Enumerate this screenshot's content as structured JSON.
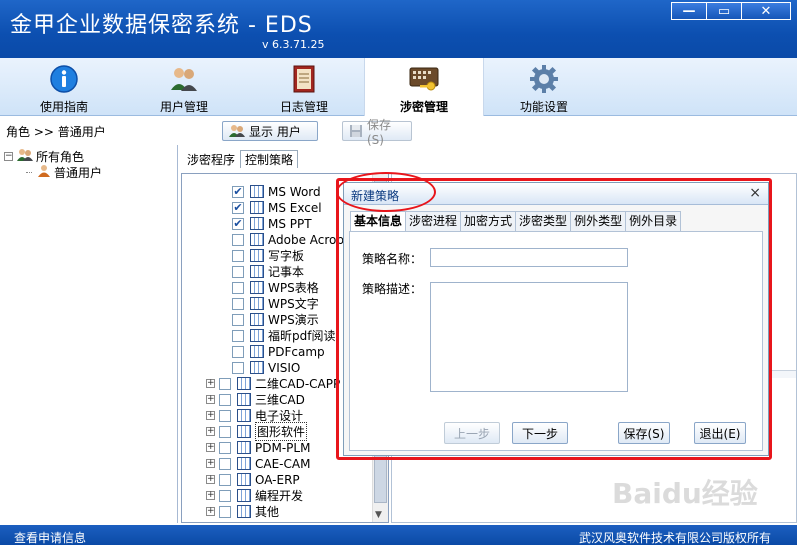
{
  "window": {
    "title": "金甲企业数据保密系统 - EDS",
    "version": "v 6.3.71.25",
    "minimize": "—",
    "restore": "▭",
    "close": "✕"
  },
  "toolbar": {
    "tabs": [
      {
        "label": "使用指南",
        "icon": "info-icon"
      },
      {
        "label": "用户管理",
        "icon": "users-icon"
      },
      {
        "label": "日志管理",
        "icon": "log-book-icon"
      },
      {
        "label": "涉密管理",
        "icon": "key-keyboard-icon"
      },
      {
        "label": "功能设置",
        "icon": "gear-icon"
      }
    ],
    "active": "涉密管理"
  },
  "breadcrumb": "角色 >> 普通用户",
  "buttons": {
    "show_user": "显示 用户",
    "save": "保存(S)"
  },
  "role_tree": {
    "root": "所有角色",
    "child": "普通用户"
  },
  "mid_tabs": [
    "涉密程序",
    "控制策略"
  ],
  "program_list": {
    "checked_items": [
      "MS Word",
      "MS Excel",
      "MS PPT"
    ],
    "unchecked_items": [
      "Adobe Acrob",
      "写字板",
      "记事本",
      "WPS表格",
      "WPS文字",
      "WPS演示",
      "福昕pdf阅读",
      "PDFcamp",
      "VISIO"
    ],
    "groups": [
      "二维CAD-CAPP",
      "三维CAD",
      "电子设计",
      "图形软件",
      "PDM-PLM",
      "CAE-CAM",
      "OA-ERP",
      "编程开发",
      "其他"
    ],
    "selected_group": "图形软件"
  },
  "dialog": {
    "title": "新建策略",
    "close": "×",
    "tabs": [
      "基本信息",
      "涉密进程",
      "加密方式",
      "涉密类型",
      "例外类型",
      "例外目录"
    ],
    "active_tab": "基本信息",
    "name_label": "策略名称：",
    "name_value": "",
    "desc_label": "策略描述：",
    "desc_value": "",
    "btn_prev": "上一步",
    "btn_next": "下一步",
    "btn_save": "保存(S)",
    "btn_exit": "退出(E)"
  },
  "status": {
    "left": "查看申请信息",
    "right": "武汉风奥软件技术有限公司版权所有"
  },
  "watermark": "Baidu经验",
  "colors": {
    "titlebar": "#0c4fb0",
    "annotation_red": "#e8151b"
  }
}
